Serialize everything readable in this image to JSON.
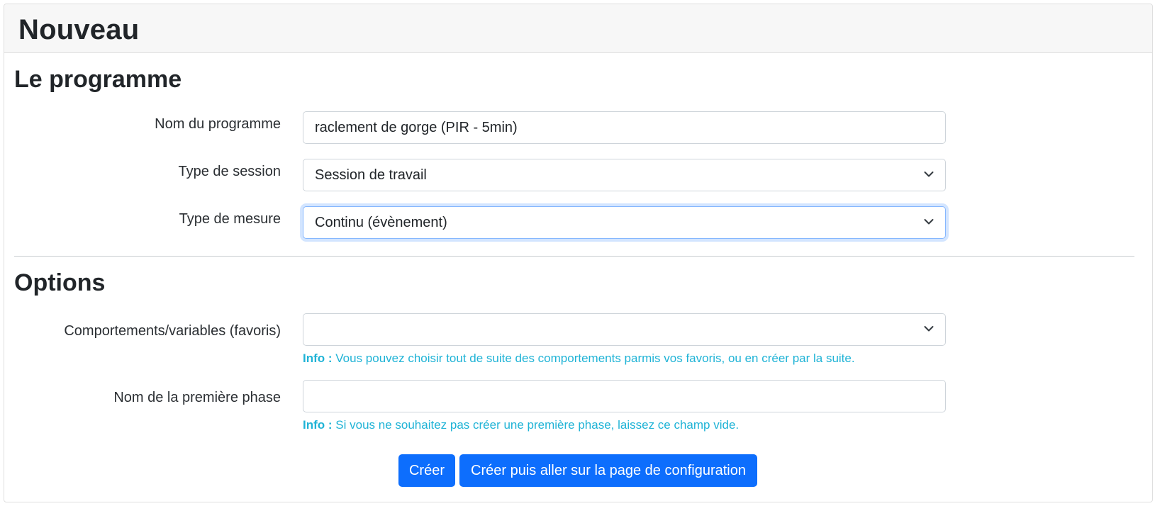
{
  "card": {
    "title": "Nouveau"
  },
  "program_section": {
    "title": "Le programme",
    "name_label": "Nom du programme",
    "name_value": "raclement de gorge (PIR - 5min)",
    "session_type_label": "Type de session",
    "session_type_value": "Session de travail",
    "measure_type_label": "Type de mesure",
    "measure_type_value": "Continu (évènement)"
  },
  "options_section": {
    "title": "Options",
    "behaviors_label": "Comportements/variables (favoris)",
    "behaviors_value": "",
    "behaviors_help_prefix": "Info :",
    "behaviors_help_text": " Vous pouvez choisir tout de suite des comportements parmis vos favoris, ou en créer par la suite.",
    "first_phase_label": "Nom de la première phase",
    "first_phase_value": "",
    "first_phase_help_prefix": "Info :",
    "first_phase_help_text": " Si vous ne souhaitez pas créer une première phase, laissez ce champ vide."
  },
  "actions": {
    "create_label": "Créer",
    "create_and_configure_label": "Créer puis aller sur la page de configuration"
  },
  "colors": {
    "primary": "#0d6efd",
    "info": "#1fb3d6",
    "header_bg": "#f7f7f7",
    "focus_border": "#86b7fe"
  }
}
